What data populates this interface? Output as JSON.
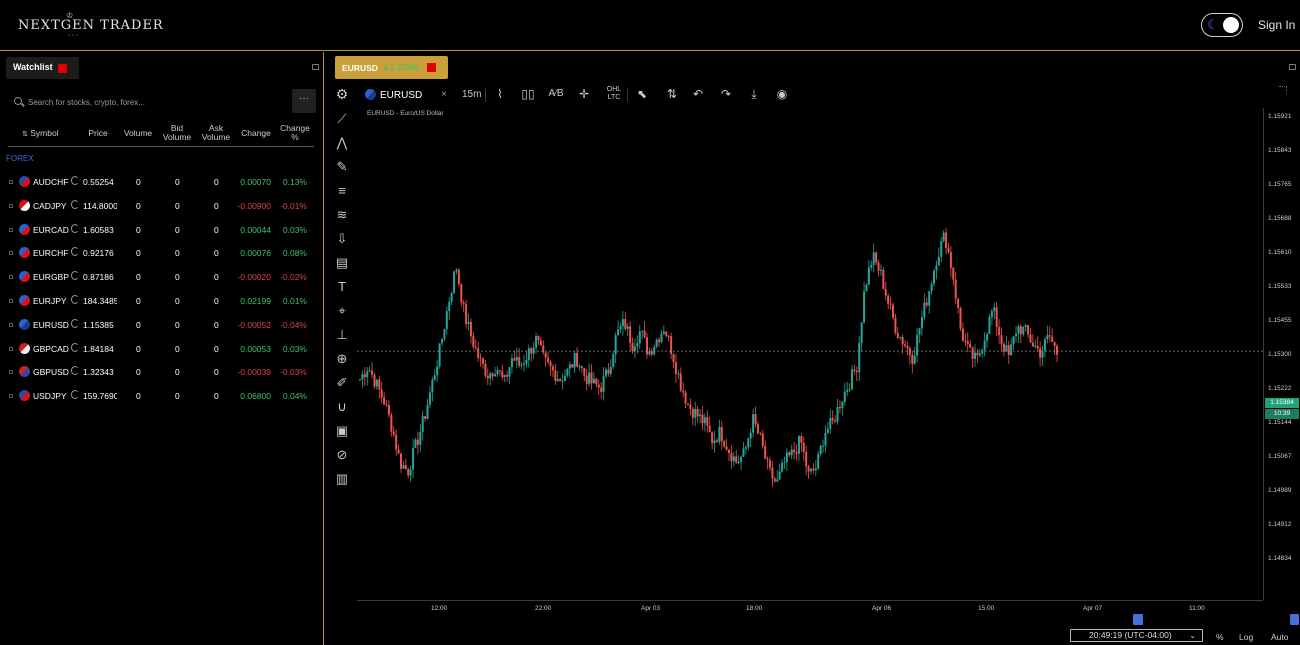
{
  "header": {
    "logo_text": "NEXTGEN TRADER",
    "signin_label": "Sign In",
    "theme_icon": "moon-icon"
  },
  "watchlist": {
    "tab_label": "Watchlist",
    "search_placeholder": "Search for stocks, crypto, forex...",
    "more_label": "···",
    "columns": {
      "symbol": "Symbol",
      "price": "Price",
      "volume": "Volume",
      "bid_volume": "Bid Volume",
      "ask_volume": "Ask Volume",
      "change": "Change",
      "change_pct": "Change %"
    },
    "group_label": "FOREX",
    "rows": [
      {
        "symbol": "AUDCHF",
        "price": "0.55254",
        "volume": "0",
        "bid": "0",
        "ask": "0",
        "change": "0.00070",
        "change_pct": "0.13%",
        "dir": "pos"
      },
      {
        "symbol": "CADJPY",
        "price": "114.80000",
        "volume": "0",
        "bid": "0",
        "ask": "0",
        "change": "-0.00900",
        "change_pct": "-0.01%",
        "dir": "neg"
      },
      {
        "symbol": "EURCAD",
        "price": "1.60583",
        "volume": "0",
        "bid": "0",
        "ask": "0",
        "change": "0.00044",
        "change_pct": "0.03%",
        "dir": "pos"
      },
      {
        "symbol": "EURCHF",
        "price": "0.92176",
        "volume": "0",
        "bid": "0",
        "ask": "0",
        "change": "0.00076",
        "change_pct": "0.08%",
        "dir": "pos"
      },
      {
        "symbol": "EURGBP",
        "price": "0.87186",
        "volume": "0",
        "bid": "0",
        "ask": "0",
        "change": "-0.00020",
        "change_pct": "-0.02%",
        "dir": "neg"
      },
      {
        "symbol": "EURJPY",
        "price": "184.34850",
        "volume": "0",
        "bid": "0",
        "ask": "0",
        "change": "0.02199",
        "change_pct": "0.01%",
        "dir": "pos"
      },
      {
        "symbol": "EURUSD",
        "price": "1.15385",
        "volume": "0",
        "bid": "0",
        "ask": "0",
        "change": "-0.00052",
        "change_pct": "-0.04%",
        "dir": "neg"
      },
      {
        "symbol": "GBPCAD",
        "price": "1.84184",
        "volume": "0",
        "bid": "0",
        "ask": "0",
        "change": "0.00053",
        "change_pct": "0.03%",
        "dir": "pos"
      },
      {
        "symbol": "GBPUSD",
        "price": "1.32343",
        "volume": "0",
        "bid": "0",
        "ask": "0",
        "change": "-0.00039",
        "change_pct": "-0.03%",
        "dir": "neg"
      },
      {
        "symbol": "USDJPY",
        "price": "159.76900",
        "volume": "0",
        "bid": "0",
        "ask": "0",
        "change": "0.06800",
        "change_pct": "0.04%",
        "dir": "pos"
      }
    ]
  },
  "chart": {
    "tab_symbol": "EURUSD",
    "tab_price": "▲1.15385",
    "toolbar_symbol": "EURUSD",
    "interval": "15m",
    "caption": "EURUSD - Euro/US Dollar",
    "price_labels": [
      "1.15921",
      "1.15843",
      "1.15765",
      "1.15688",
      "1.15610",
      "1.15533",
      "1.15455",
      "1.15384",
      "1.15300",
      "1.15222",
      "1.15144",
      "1.15067",
      "1.14989",
      "1.14912",
      "1.14834"
    ],
    "current_price": "1.15384",
    "countdown": "10:39",
    "time_labels": [
      "12:00",
      "22:00",
      "Apr 03",
      "18:00",
      "Apr 06",
      "15:00",
      "Apr 07",
      "11:00"
    ],
    "timezone": "20:49:19 (UTC-04:00)",
    "bottom_options": [
      "%",
      "Log",
      "Auto"
    ],
    "colors": {
      "up": "#26a69a",
      "down": "#ef5350",
      "accent": "#c9a03a",
      "border": "#b8912e"
    }
  },
  "chart_data": {
    "type": "candlestick",
    "title": "EURUSD - Euro/US Dollar",
    "interval": "15m",
    "ylim": [
      1.14834,
      1.15921
    ],
    "x_ticks": [
      "12:00",
      "22:00",
      "Apr 03",
      "18:00",
      "Apr 06",
      "15:00",
      "Apr 07",
      "11:00"
    ],
    "y_ticks": [
      1.15921,
      1.15843,
      1.15765,
      1.15688,
      1.1561,
      1.15533,
      1.15455,
      1.15384,
      1.153,
      1.15222,
      1.15144,
      1.15067,
      1.14989,
      1.14912,
      1.14834
    ],
    "last_price": 1.15384,
    "path_close": [
      1.1532,
      1.1535,
      1.1531,
      1.1527,
      1.1521,
      1.1513,
      1.1511,
      1.1517,
      1.1523,
      1.1531,
      1.1539,
      1.1549,
      1.1558,
      1.1547,
      1.1541,
      1.1536,
      1.1533,
      1.1535,
      1.1531,
      1.1537,
      1.1535,
      1.1538,
      1.1541,
      1.1536,
      1.1534,
      1.1532,
      1.1534,
      1.1537,
      1.1533,
      1.1531,
      1.153,
      1.1534,
      1.1542,
      1.1545,
      1.154,
      1.1543,
      1.1538,
      1.1541,
      1.1544,
      1.1538,
      1.1531,
      1.1526,
      1.1524,
      1.1522,
      1.1518,
      1.152,
      1.1516,
      1.1513,
      1.1515,
      1.1523,
      1.1518,
      1.1511,
      1.1508,
      1.1513,
      1.1515,
      1.1518,
      1.151,
      1.1512,
      1.152,
      1.1522,
      1.1527,
      1.1531,
      1.1535,
      1.1553,
      1.156,
      1.1556,
      1.1549,
      1.1543,
      1.154,
      1.1537,
      1.1545,
      1.1552,
      1.156,
      1.1565,
      1.1556,
      1.1543,
      1.1538,
      1.1536,
      1.1542,
      1.1548,
      1.1541,
      1.1537,
      1.1544,
      1.1543,
      1.154,
      1.1538,
      1.1542,
      1.1538
    ]
  }
}
